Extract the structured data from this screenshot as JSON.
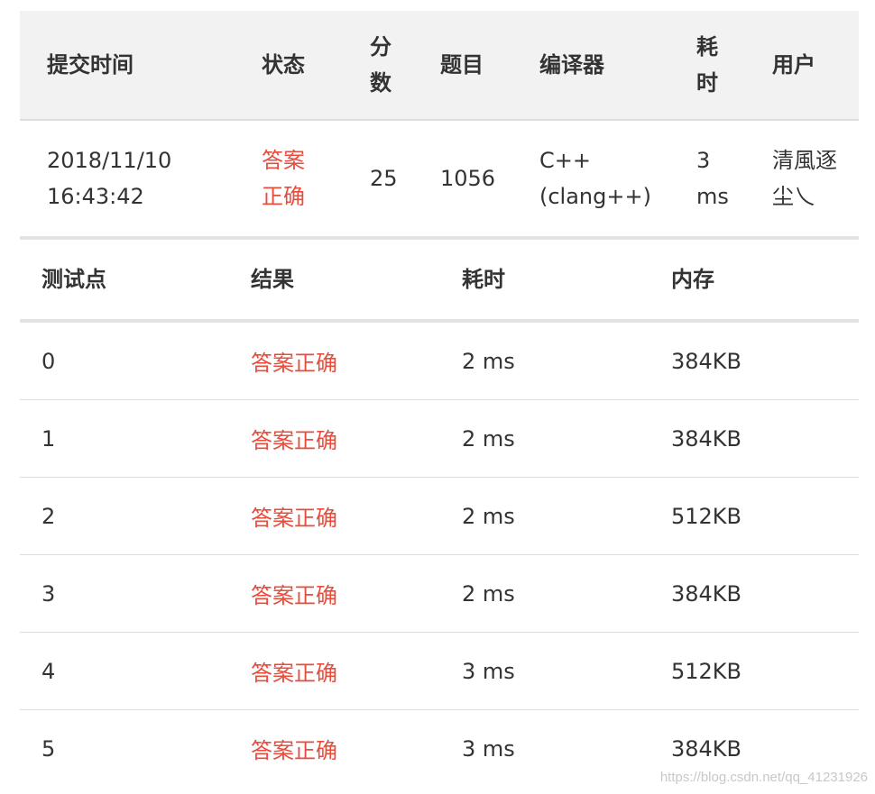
{
  "submission": {
    "headers": {
      "time": "提交时间",
      "status": "状态",
      "score": "分\n数",
      "problem": "题目",
      "compiler": "编译器",
      "elapsed": "耗\n时",
      "user": "用户"
    },
    "row": {
      "time": "2018/11/10\n16:43:42",
      "status": "答案\n正确",
      "score": "25",
      "problem": "1056",
      "compiler": "C++\n(clang++)",
      "elapsed": "3\nms",
      "user": "清風逐\n尘乀"
    }
  },
  "testcases": {
    "headers": {
      "case": "测试点",
      "result": "结果",
      "time": "耗时",
      "memory": "内存"
    },
    "rows": [
      {
        "case": "0",
        "result": "答案正确",
        "time": "2 ms",
        "memory": "384KB"
      },
      {
        "case": "1",
        "result": "答案正确",
        "time": "2 ms",
        "memory": "384KB"
      },
      {
        "case": "2",
        "result": "答案正确",
        "time": "2 ms",
        "memory": "512KB"
      },
      {
        "case": "3",
        "result": "答案正确",
        "time": "2 ms",
        "memory": "384KB"
      },
      {
        "case": "4",
        "result": "答案正确",
        "time": "3 ms",
        "memory": "512KB"
      },
      {
        "case": "5",
        "result": "答案正确",
        "time": "3 ms",
        "memory": "384KB"
      }
    ]
  },
  "watermark": "https://blog.csdn.net/qq_41231926",
  "colors": {
    "accepted": "#e74c3c",
    "header_bg": "#f2f2f2",
    "text": "#333333"
  }
}
